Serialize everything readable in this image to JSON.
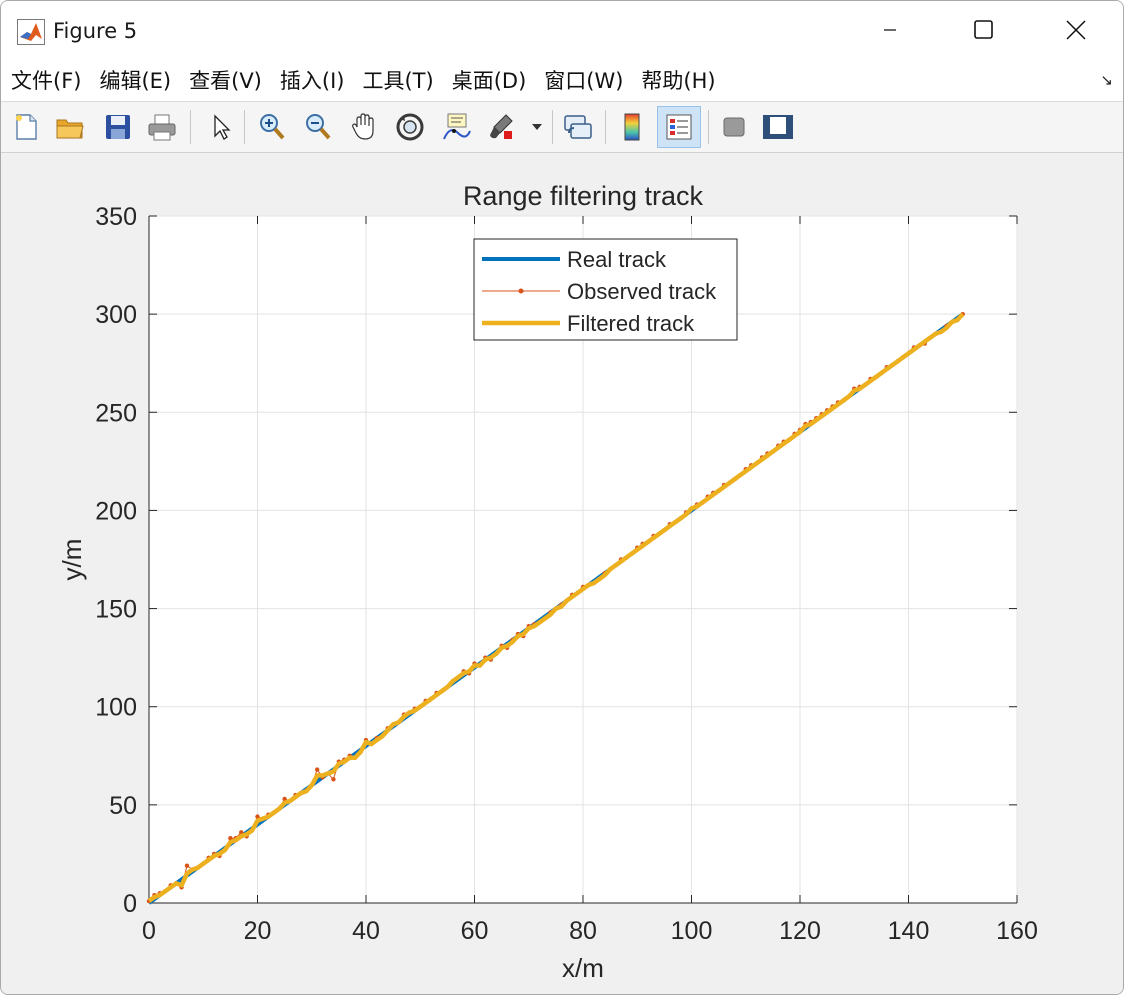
{
  "window": {
    "title": "Figure 5"
  },
  "menu": {
    "items": [
      "文件(F)",
      "编辑(E)",
      "查看(V)",
      "插入(I)",
      "工具(T)",
      "桌面(D)",
      "窗口(W)",
      "帮助(H)"
    ]
  },
  "toolbar": {
    "icons": [
      "new-figure-icon",
      "open-file-icon",
      "save-icon",
      "print-icon",
      "pointer-icon",
      "zoom-in-icon",
      "zoom-out-icon",
      "pan-hand-icon",
      "rotate-3d-icon",
      "data-cursor-icon",
      "brush-icon",
      "link-plot-icon",
      "colorbar-icon",
      "legend-icon",
      "hide-plot-tools-icon",
      "show-plot-tools-icon"
    ]
  },
  "colors": {
    "real": "#0072bd",
    "observed": "#d95319",
    "filtered": "#edb120",
    "grid": "#e3e3e3",
    "axes": "#262626"
  },
  "chart_data": {
    "type": "line",
    "title": "Range filtering track",
    "xlabel": "x/m",
    "ylabel": "y/m",
    "xlim": [
      0,
      160
    ],
    "ylim": [
      0,
      350
    ],
    "xticks": [
      0,
      20,
      40,
      60,
      80,
      100,
      120,
      140,
      160
    ],
    "yticks": [
      0,
      50,
      100,
      150,
      200,
      250,
      300,
      350
    ],
    "grid": true,
    "legend_position": "top-center",
    "series": [
      {
        "name": "Real track",
        "style": "line",
        "x": [
          0,
          150
        ],
        "y": [
          0,
          300
        ]
      },
      {
        "name": "Observed track",
        "style": "line-dots",
        "x": [
          0,
          1,
          2,
          3,
          4,
          5,
          6,
          7,
          8,
          9,
          10,
          11,
          12,
          13,
          14,
          15,
          16,
          17,
          18,
          19,
          20,
          21,
          22,
          23,
          24,
          25,
          26,
          27,
          28,
          29,
          30,
          31,
          32,
          33,
          34,
          35,
          36,
          37,
          38,
          39,
          40,
          41,
          42,
          43,
          44,
          45,
          46,
          47,
          48,
          49,
          50,
          51,
          52,
          53,
          54,
          55,
          56,
          57,
          58,
          59,
          60,
          61,
          62,
          63,
          64,
          65,
          66,
          67,
          68,
          69,
          70,
          71,
          72,
          73,
          74,
          75,
          76,
          77,
          78,
          79,
          80,
          81,
          82,
          83,
          84,
          85,
          86,
          87,
          88,
          89,
          90,
          91,
          92,
          93,
          94,
          95,
          96,
          97,
          98,
          99,
          100,
          101,
          102,
          103,
          104,
          105,
          106,
          107,
          108,
          109,
          110,
          111,
          112,
          113,
          114,
          115,
          116,
          117,
          118,
          119,
          120,
          121,
          122,
          123,
          124,
          125,
          126,
          127,
          128,
          129,
          130,
          131,
          132,
          133,
          134,
          135,
          136,
          137,
          138,
          139,
          140,
          141,
          142,
          143,
          144,
          145,
          146,
          147,
          148,
          149,
          150
        ],
        "y": [
          1,
          4,
          5,
          6,
          9,
          10,
          8,
          19,
          17,
          18,
          20,
          23,
          25,
          24,
          27,
          33,
          33,
          36,
          34,
          37,
          44,
          43,
          45,
          46,
          48,
          53,
          52,
          55,
          56,
          57,
          60,
          68,
          64,
          66,
          63,
          72,
          73,
          75,
          74,
          77,
          83,
          81,
          84,
          85,
          89,
          91,
          92,
          96,
          97,
          99,
          100,
          103,
          104,
          107,
          108,
          110,
          113,
          115,
          118,
          117,
          122,
          121,
          125,
          124,
          127,
          131,
          130,
          134,
          137,
          136,
          141,
          142,
          143,
          145,
          148,
          150,
          152,
          154,
          157,
          158,
          161,
          162,
          163,
          165,
          168,
          170,
          172,
          175,
          176,
          178,
          181,
          183,
          184,
          187,
          188,
          190,
          193,
          194,
          196,
          199,
          201,
          203,
          204,
          207,
          209,
          210,
          213,
          214,
          216,
          218,
          221,
          223,
          224,
          227,
          229,
          230,
          233,
          235,
          236,
          239,
          241,
          244,
          245,
          247,
          249,
          251,
          253,
          255,
          256,
          258,
          262,
          263,
          264,
          267,
          268,
          270,
          273,
          274,
          276,
          278,
          280,
          283,
          284,
          285,
          288,
          290,
          291,
          294,
          296,
          297,
          300
        ]
      },
      {
        "name": "Filtered track",
        "style": "line",
        "x": [
          0,
          1,
          2,
          3,
          4,
          5,
          6,
          7,
          8,
          9,
          10,
          11,
          12,
          13,
          14,
          15,
          16,
          17,
          18,
          19,
          20,
          21,
          22,
          23,
          24,
          25,
          26,
          27,
          28,
          29,
          30,
          31,
          32,
          33,
          34,
          35,
          36,
          37,
          38,
          39,
          40,
          41,
          42,
          43,
          44,
          45,
          46,
          47,
          48,
          49,
          50,
          51,
          52,
          53,
          54,
          55,
          56,
          57,
          58,
          59,
          60,
          61,
          62,
          63,
          64,
          65,
          66,
          67,
          68,
          69,
          70,
          71,
          72,
          73,
          74,
          75,
          76,
          77,
          78,
          79,
          80,
          81,
          82,
          83,
          84,
          85,
          86,
          87,
          88,
          89,
          90,
          91,
          92,
          93,
          94,
          95,
          96,
          97,
          98,
          99,
          100,
          101,
          102,
          103,
          104,
          105,
          106,
          107,
          108,
          109,
          110,
          111,
          112,
          113,
          114,
          115,
          116,
          117,
          118,
          119,
          120,
          121,
          122,
          123,
          124,
          125,
          126,
          127,
          128,
          129,
          130,
          131,
          132,
          133,
          134,
          135,
          136,
          137,
          138,
          139,
          140,
          141,
          142,
          143,
          144,
          145,
          146,
          147,
          148,
          149,
          150
        ],
        "y": [
          1,
          3,
          4,
          6,
          8,
          10,
          9,
          15,
          17,
          18,
          20,
          22,
          24,
          25,
          27,
          31,
          32,
          34,
          35,
          37,
          42,
          43,
          44,
          46,
          48,
          51,
          52,
          54,
          56,
          57,
          60,
          65,
          65,
          66,
          67,
          71,
          72,
          74,
          74,
          77,
          82,
          81,
          83,
          85,
          88,
          91,
          92,
          95,
          97,
          98,
          100,
          102,
          104,
          106,
          108,
          110,
          113,
          115,
          117,
          118,
          121,
          121,
          124,
          125,
          127,
          130,
          131,
          133,
          136,
          137,
          140,
          141,
          143,
          145,
          147,
          150,
          151,
          154,
          156,
          158,
          160,
          162,
          163,
          165,
          167,
          170,
          172,
          174,
          176,
          178,
          180,
          182,
          184,
          186,
          188,
          190,
          192,
          194,
          196,
          198,
          201,
          202,
          204,
          206,
          208,
          210,
          212,
          214,
          216,
          218,
          220,
          222,
          224,
          226,
          228,
          230,
          232,
          234,
          236,
          238,
          240,
          243,
          244,
          246,
          248,
          250,
          252,
          254,
          256,
          258,
          261,
          262,
          264,
          266,
          268,
          270,
          272,
          274,
          276,
          278,
          280,
          282,
          284,
          286,
          288,
          290,
          291,
          293,
          296,
          297,
          300
        ]
      }
    ]
  }
}
